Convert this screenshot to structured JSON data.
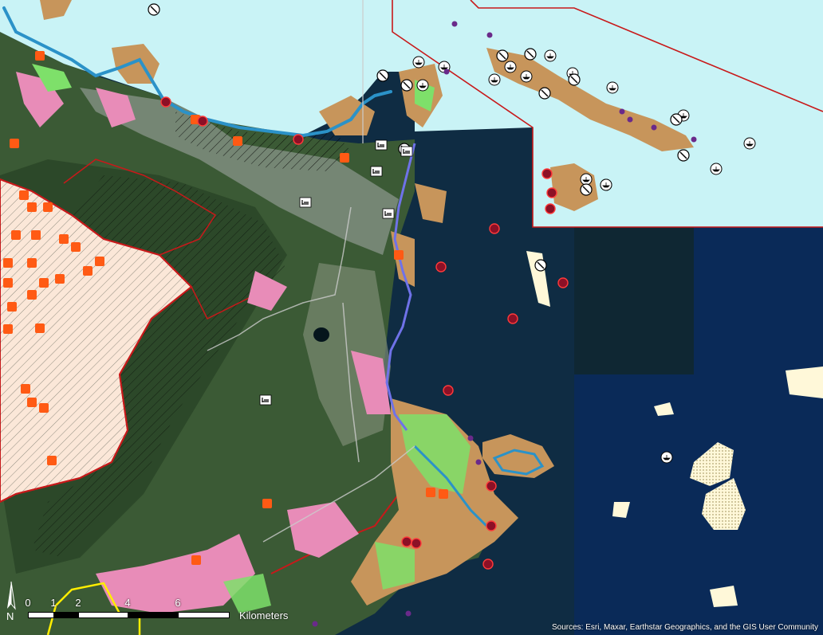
{
  "map": {
    "colors": {
      "sea_light": "#c9f3f6",
      "deep_water": "#0e2a3f",
      "land_dark": "#2d4c2b",
      "land_mid": "#4a6b3c",
      "urban": "#7b8a7a",
      "boundary_red": "#c8191a",
      "sand_tan": "#c7955b",
      "pink_zone": "#e88cb8",
      "green_zone": "#7ee06a",
      "blue_line": "#2b92c8",
      "orange_marker": "#ff5a14",
      "reef_dotted": "#fff8d9",
      "hatched_fill": "#ffe9da"
    },
    "icons": {
      "boat_marker": "anchor-boat-icon",
      "bed_marker": "lodging-icon",
      "no_entry_marker": "restricted-icon",
      "red_circle_marker": "dive-site-icon",
      "orange_square_marker": "site-square-icon"
    }
  },
  "scalebar": {
    "ticks": [
      "0",
      "1",
      "2",
      "4",
      "6"
    ],
    "units": "Kilometers"
  },
  "north_arrow": {
    "label": "N"
  },
  "attribution": "Sources: Esri, Maxar, Earthstar Geographics, and the GIS User Community"
}
